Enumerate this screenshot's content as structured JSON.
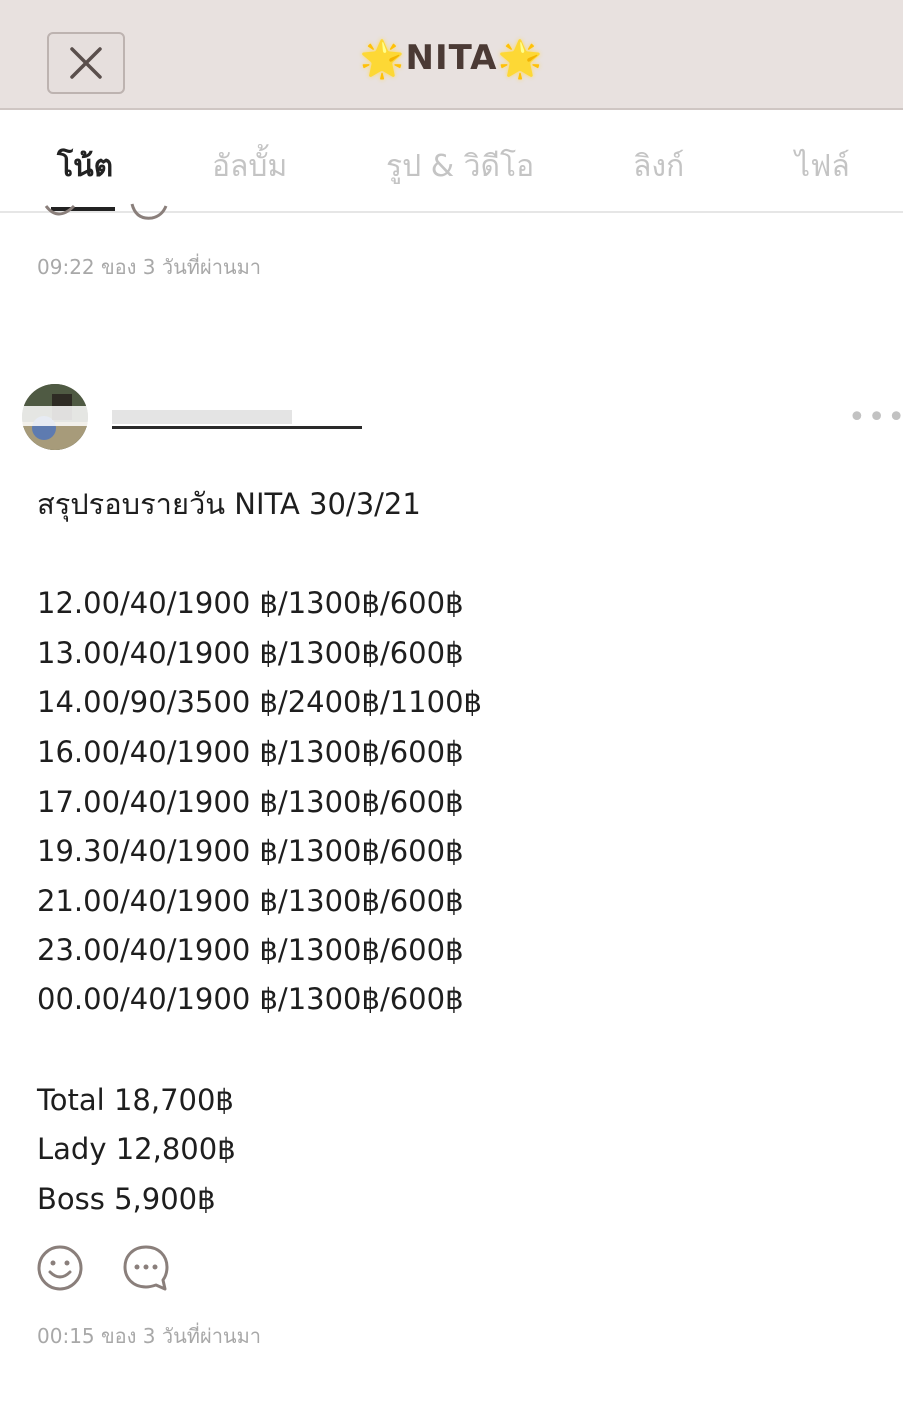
{
  "header": {
    "title": "NITA",
    "star_left": "🌟",
    "star_right": "🌟",
    "close_icon": "close-icon"
  },
  "tabs": [
    {
      "label": "โน้ต",
      "active": true
    },
    {
      "label": "อัลบั้ม",
      "active": false
    },
    {
      "label": "รูป & วิดีโอ",
      "active": false
    },
    {
      "label": "ลิงก์",
      "active": false
    },
    {
      "label": "ไฟล์",
      "active": false
    }
  ],
  "previous_post": {
    "timestamp": "09:22 ของ 3 วันที่ผ่านมา"
  },
  "post": {
    "title": "สรุปรอบรายวัน NITA 30/3/21",
    "lines": [
      "12.00/40/1900 ฿/1300฿/600฿",
      "13.00/40/1900 ฿/1300฿/600฿",
      "14.00/90/3500 ฿/2400฿/1100฿",
      "16.00/40/1900 ฿/1300฿/600฿",
      "17.00/40/1900 ฿/1300฿/600฿",
      "19.30/40/1900 ฿/1300฿/600฿",
      "21.00/40/1900 ฿/1300฿/600฿",
      "23.00/40/1900 ฿/1300฿/600฿",
      "00.00/40/1900 ฿/1300฿/600฿"
    ],
    "summary": [
      "Total 18,700฿",
      "Lady 12,800฿",
      "Boss 5,900฿"
    ],
    "timestamp": "00:15 ของ 3 วันที่ผ่านมา",
    "more_label": "•••"
  },
  "colors": {
    "header_bg": "#e8e1df",
    "title_text": "#4b3a35",
    "tab_inactive": "#c4c4c4",
    "tab_active": "#222222",
    "meta_text": "#a8a8a8",
    "icon_stroke": "#8a7f7b"
  }
}
